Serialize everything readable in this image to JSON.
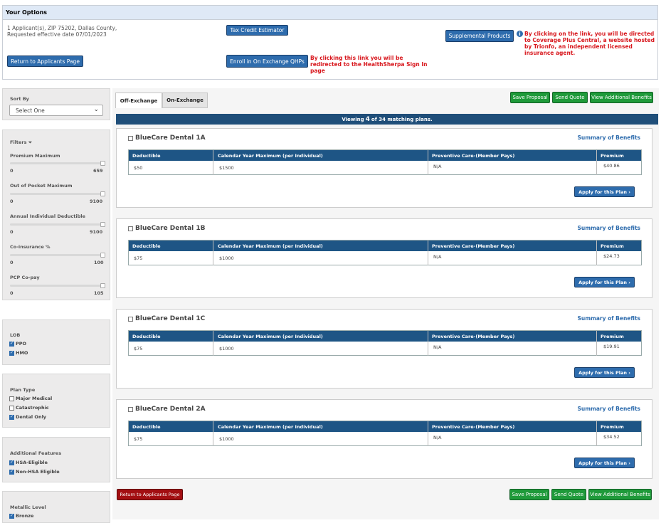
{
  "options": {
    "title": "Your Options",
    "applicant_line1": "1 Applicant(s), ZIP 75202, Dallas County,",
    "applicant_line2": "Requested effective date 07/01/2023",
    "tax_credit_label": "Tax Credit Estimator",
    "supplemental_label": "Supplemental Products",
    "supplemental_note": "By clicking on the link, you will be directed to Coverage Plus Central, a website hosted by Trionfo, an independent licensed insurance agent.",
    "return_label": "Return to Applicants Page",
    "enroll_label": "Enroll in On Exchange QHPs",
    "enroll_note": "By clicking this link you will be redirected to the HealthSherpa Sign In page"
  },
  "sidebar": {
    "sort_by_label": "Sort By",
    "sort_by_value": "Select One",
    "filters_label": "Filters ⏷",
    "sliders": [
      {
        "label": "Premium Maximum",
        "min": "0",
        "max": "659"
      },
      {
        "label": "Out of Pocket Maximum",
        "min": "0",
        "max": "9100"
      },
      {
        "label": "Annual Individual Deductible",
        "min": "0",
        "max": "9100"
      },
      {
        "label": "Co-insurance %",
        "min": "0",
        "max": "100"
      },
      {
        "label": "PCP Co-pay",
        "min": "0",
        "max": "105"
      }
    ],
    "lob": {
      "title": "LOB",
      "options": [
        {
          "label": "PPO",
          "checked": true
        },
        {
          "label": "HMO",
          "checked": true
        }
      ]
    },
    "plan_type": {
      "title": "Plan Type",
      "options": [
        {
          "label": "Major Medical",
          "checked": false
        },
        {
          "label": "Catastrophic",
          "checked": false
        },
        {
          "label": "Dental Only",
          "checked": true
        }
      ]
    },
    "additional": {
      "title": "Additional Features",
      "options": [
        {
          "label": "HSA-Eligible",
          "checked": true
        },
        {
          "label": "Non-HSA Eligible",
          "checked": true
        }
      ]
    },
    "metallic": {
      "title": "Metallic Level",
      "options": [
        {
          "label": "Bronze",
          "checked": true
        }
      ]
    }
  },
  "tabs": [
    "Off-Exchange",
    "On-Exchange"
  ],
  "actions": {
    "save_proposal": "Save Proposal",
    "send_quote": "Send Quote",
    "view_benefits": "View Additional Benefits",
    "return_bottom": "Return to Applicants Page"
  },
  "viewing": {
    "prefix": "Viewing",
    "count": "4",
    "suffix": "of 34 matching plans."
  },
  "table_headers": [
    "Deductible",
    "Calendar Year Maximum (per Individual)",
    "Preventive Care-(Member Pays)",
    "Premium"
  ],
  "sob_label": "Summary of Benefits",
  "apply_label": "Apply for this Plan ›",
  "plans": [
    {
      "name": "BlueCare Dental 1A",
      "deductible": "$50",
      "max": "$1500",
      "preventive": "N/A",
      "premium": "$40.86"
    },
    {
      "name": "BlueCare Dental 1B",
      "deductible": "$75",
      "max": "$1000",
      "preventive": "N/A",
      "premium": "$24.73"
    },
    {
      "name": "BlueCare Dental 1C",
      "deductible": "$75",
      "max": "$1000",
      "preventive": "N/A",
      "premium": "$19.91"
    },
    {
      "name": "BlueCare Dental 2A",
      "deductible": "$75",
      "max": "$1000",
      "preventive": "N/A",
      "premium": "$34.52"
    }
  ]
}
